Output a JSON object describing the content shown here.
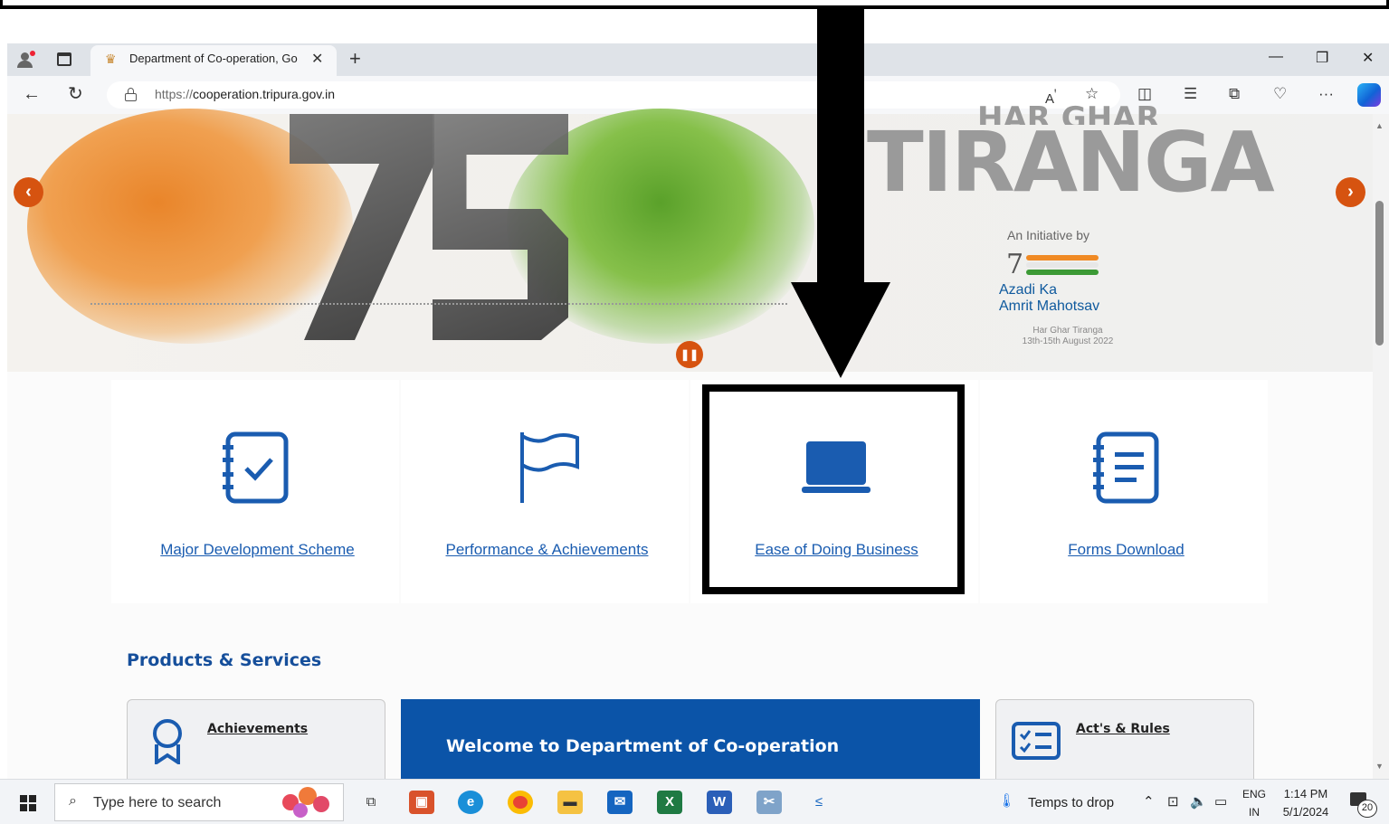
{
  "browser": {
    "tab_title": "Department of Co-operation, Go",
    "url_protocol": "https://",
    "url_host": "cooperation.tripura.gov.in",
    "new_tab_label": "+",
    "tab_close_label": "✕"
  },
  "banner": {
    "heading": "TIRANGA",
    "heading_top": "HAR GHAR",
    "initiative": "An Initiative by",
    "logo_line1": "Azadi Ka",
    "logo_line2": "Amrit Mahotsav",
    "sub_line1": "Har Ghar Tiranga",
    "sub_line2": "13th-15th August 2022",
    "prev_label": "‹",
    "next_label": "›",
    "pause_label": "❚❚"
  },
  "cards": [
    {
      "label": "Major Development Scheme",
      "icon": "checklist-icon"
    },
    {
      "label": "Performance & Achievements",
      "icon": "flag-icon"
    },
    {
      "label": "Ease of Doing Business",
      "icon": "laptop-icon"
    },
    {
      "label": "Forms Download",
      "icon": "form-list-icon"
    }
  ],
  "products": {
    "title": "Products & Services",
    "left_panel": "Achievements",
    "welcome": "Welcome to Department of Co-operation",
    "right_panel": "Act's & Rules"
  },
  "taskbar": {
    "search_placeholder": "Type here to search",
    "weather": "Temps to drop",
    "lang_line1": "ENG",
    "lang_line2": "IN",
    "time": "1:14 PM",
    "date": "5/1/2024",
    "notification_count": "20"
  },
  "colors": {
    "accent_blue": "#1a5cb0",
    "banner_button": "#d65310",
    "welcome_bg": "#0b54a8"
  }
}
